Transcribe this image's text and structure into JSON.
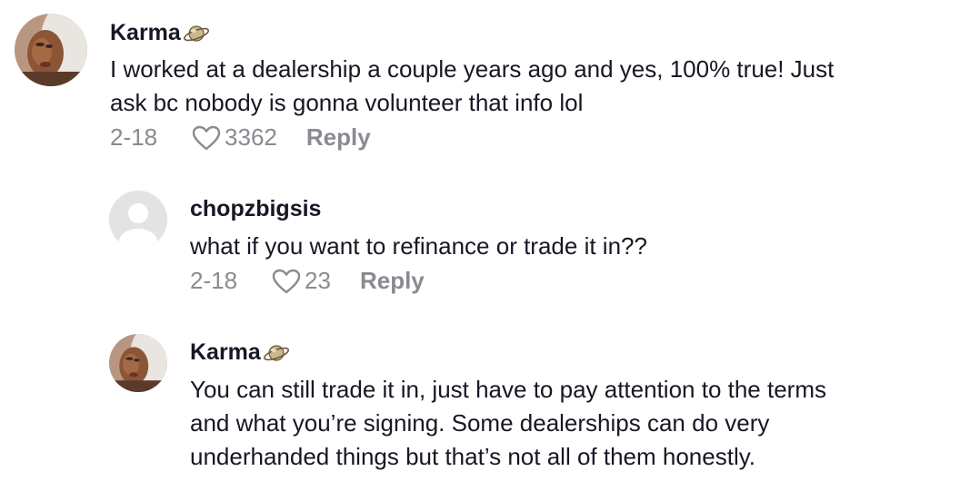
{
  "comments": [
    {
      "username": "Karma",
      "badge_icon": "planet-icon",
      "avatar_icon": "user-photo-avatar",
      "lines": [
        "I worked at a dealership a couple years ago and yes, 100% true! Just",
        "ask bc nobody is gonna volunteer that info lol"
      ],
      "date": "2-18",
      "likes": "3362",
      "reply_label": "Reply"
    },
    {
      "username": "chopzbigsis",
      "avatar_icon": "default-avatar",
      "lines": [
        "what if you want to refinance or trade it in??"
      ],
      "date": "2-18",
      "likes": "23",
      "reply_label": "Reply"
    },
    {
      "username": "Karma",
      "badge_icon": "planet-icon",
      "avatar_icon": "user-photo-avatar",
      "lines": [
        "You can still trade it in, just have to pay attention to the terms",
        "and what you’re signing. Some dealerships can do very",
        "underhanded things but that’s not all of them honestly."
      ]
    }
  ],
  "colors": {
    "text": "#161823",
    "secondary": "#8a8b91",
    "default_avatar_bg": "#e3e3e4"
  }
}
